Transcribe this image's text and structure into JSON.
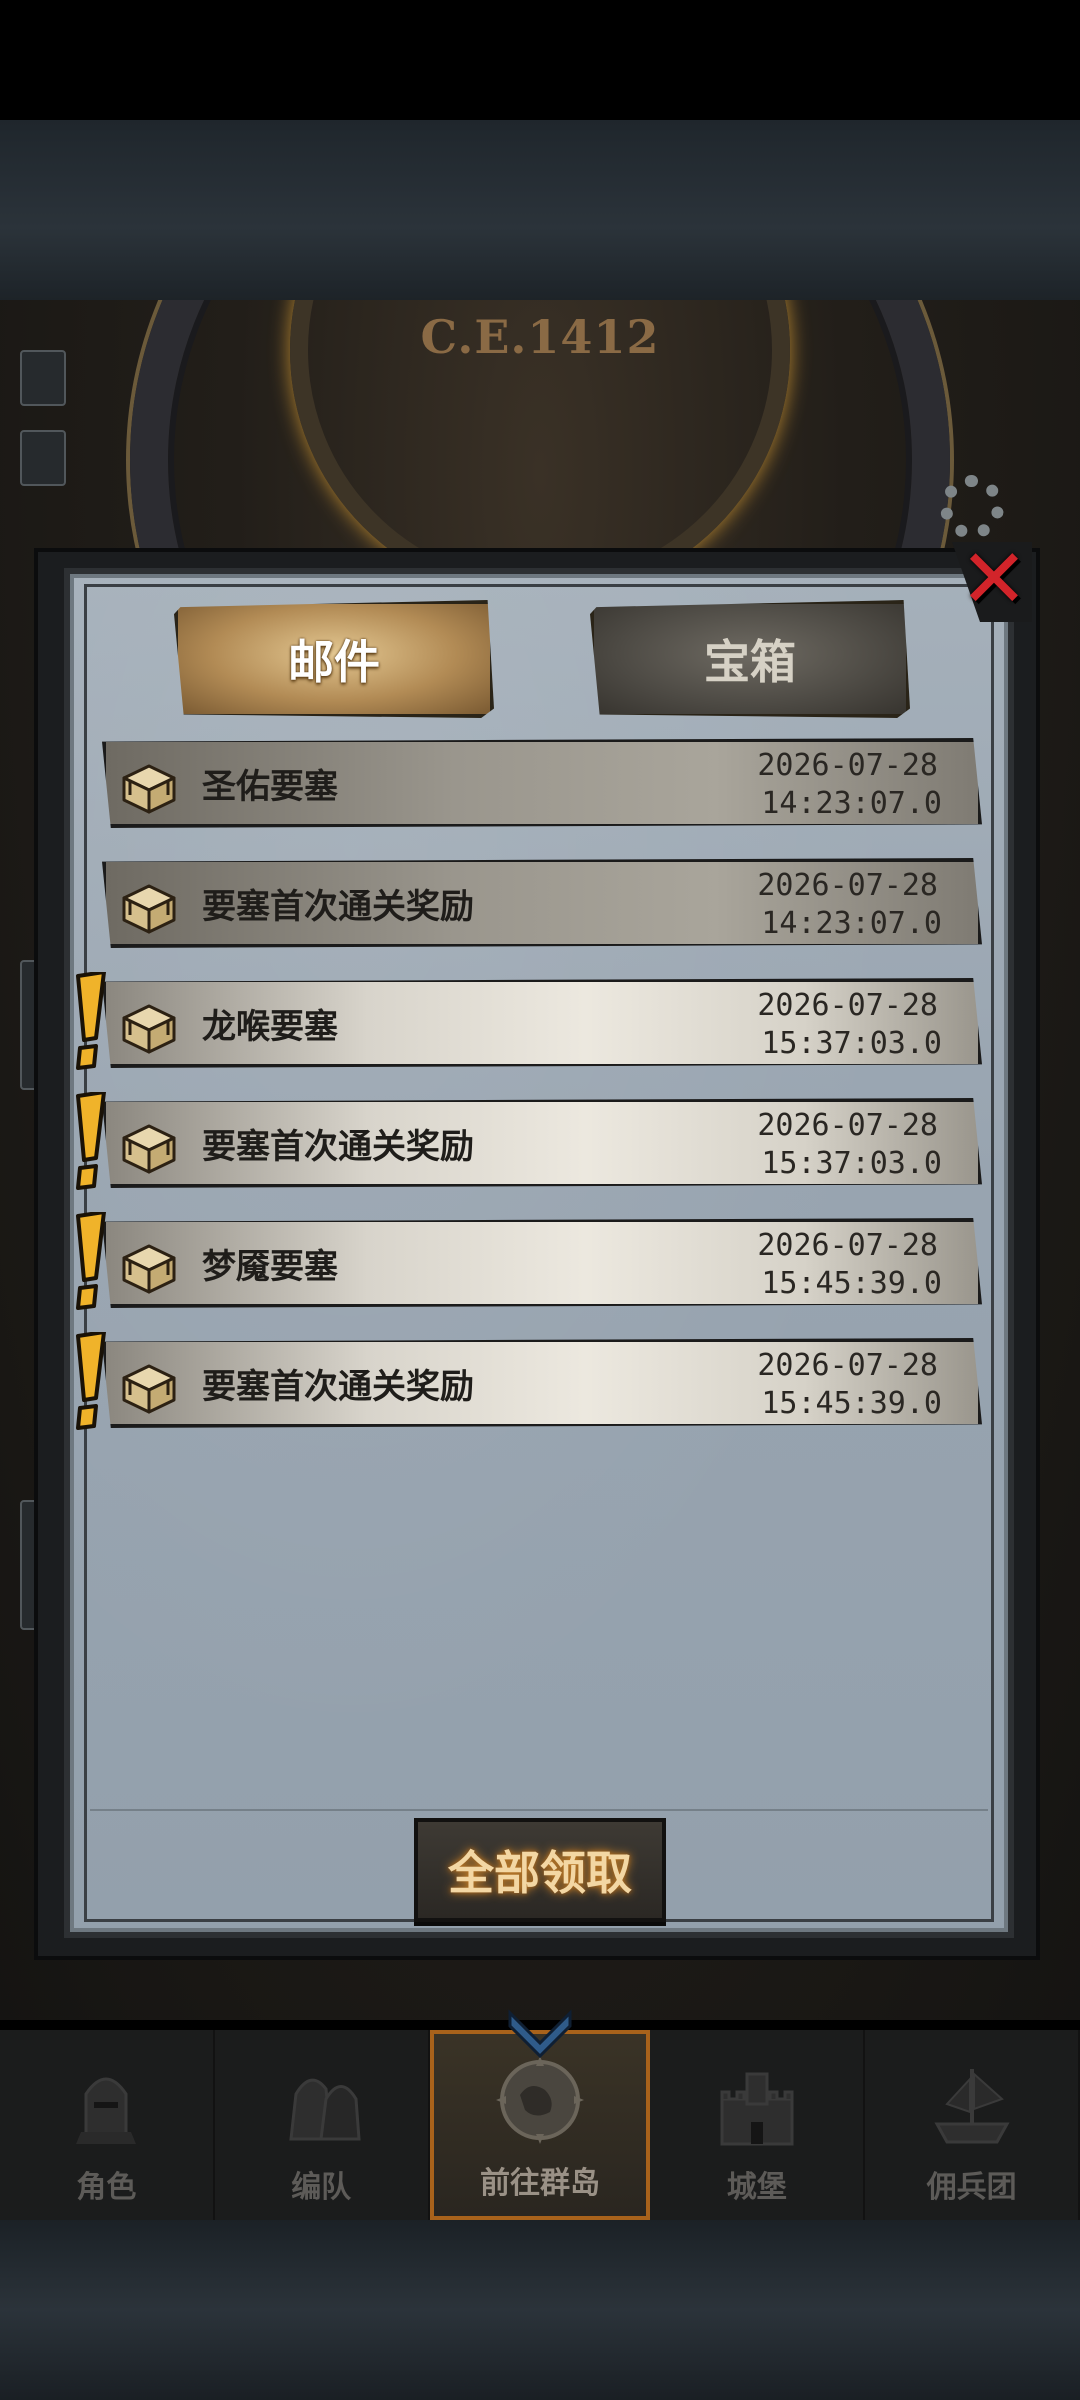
{
  "header": {
    "year_label": "C.E.1412"
  },
  "dialog": {
    "tabs": [
      {
        "label": "邮件",
        "active": true
      },
      {
        "label": "宝箱",
        "active": false
      }
    ],
    "close_icon": "close-x-icon",
    "mails": [
      {
        "title": "圣佑要塞",
        "date": "2026-07-28",
        "time": "14:23:07.0",
        "unread": false
      },
      {
        "title": "要塞首次通关奖励",
        "date": "2026-07-28",
        "time": "14:23:07.0",
        "unread": false
      },
      {
        "title": "龙喉要塞",
        "date": "2026-07-28",
        "time": "15:37:03.0",
        "unread": true
      },
      {
        "title": "要塞首次通关奖励",
        "date": "2026-07-28",
        "time": "15:37:03.0",
        "unread": true
      },
      {
        "title": "梦魇要塞",
        "date": "2026-07-28",
        "time": "15:45:39.0",
        "unread": true
      },
      {
        "title": "要塞首次通关奖励",
        "date": "2026-07-28",
        "time": "15:45:39.0",
        "unread": true
      }
    ],
    "claim_all_label": "全部领取"
  },
  "bottom_nav": {
    "items": [
      {
        "label": "角色",
        "icon": "knight-helmet-icon"
      },
      {
        "label": "编队",
        "icon": "team-formation-icon"
      },
      {
        "label": "前往群岛",
        "icon": "world-map-compass-icon",
        "active": true
      },
      {
        "label": "城堡",
        "icon": "castle-icon"
      },
      {
        "label": "佣兵团",
        "icon": "mercenary-ship-icon"
      }
    ]
  },
  "colors": {
    "accent": "#d2242a",
    "active_tab": "#c9a56c",
    "nav_active_border": "#a8621b"
  }
}
